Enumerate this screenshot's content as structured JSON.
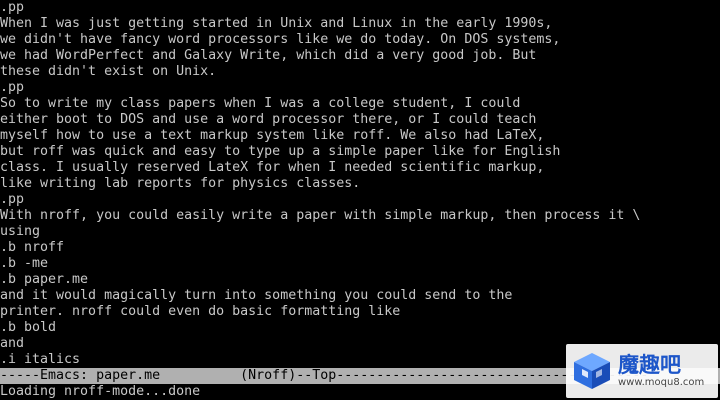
{
  "buffer": {
    "lines": [
      ".pp",
      "When I was just getting started in Unix and Linux in the early 1990s,",
      "we didn't have fancy word processors like we do today. On DOS systems,",
      "we had WordPerfect and Galaxy Write, which did a very good job. But",
      "these didn't exist on Unix.",
      ".pp",
      "So to write my class papers when I was a college student, I could",
      "either boot to DOS and use a word processor there, or I could teach",
      "myself how to use a text markup system like roff. We also had LaTeX,",
      "but roff was quick and easy to type up a simple paper like for English",
      "class. I usually reserved LateX for when I needed scientific markup,",
      "like writing lab reports for physics classes.",
      ".pp",
      "With nroff, you could easily write a paper with simple markup, then process it \\",
      "using",
      ".b nroff",
      ".b -me",
      ".b paper.me",
      "and it would magically turn into something you could send to the",
      "printer. nroff could even do basic formatting like",
      ".b bold",
      "and",
      ".i italics"
    ]
  },
  "modeline": {
    "text": "-----Emacs: paper.me          (Nroff)--Top---------------------------------------"
  },
  "minibuffer": {
    "text": "Loading nroff-mode...done"
  },
  "watermark": {
    "logo_icon": "cube-logo-icon",
    "brand_cn": "魔趣吧",
    "url": "www.moqu8.com",
    "brand_color": "#1d56c9"
  }
}
